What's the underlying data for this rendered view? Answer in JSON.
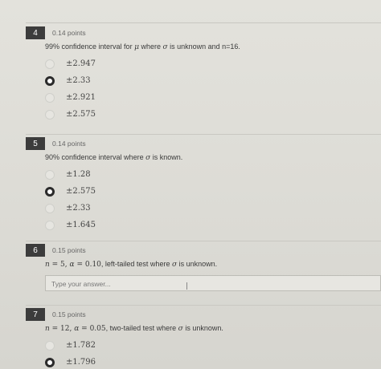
{
  "questions": [
    {
      "number": "4",
      "points": "0.14 points",
      "prompt_text": "99% confidence interval for ",
      "prompt_mu": "μ",
      "prompt_mid": " where ",
      "prompt_sigma": "σ",
      "prompt_end": " is unknown and n=16.",
      "options": [
        "±2.947",
        "±2.33",
        "±2.921",
        "±2.575"
      ],
      "selected_index": 1
    },
    {
      "number": "5",
      "points": "0.14 points",
      "prompt_text": "90% confidence interval where ",
      "prompt_sigma": "σ",
      "prompt_end": " is known.",
      "options": [
        "±1.28",
        "±2.575",
        "±2.33",
        "±1.645"
      ],
      "selected_index": 1
    },
    {
      "number": "6",
      "points": "0.15 points",
      "prompt_n": "n",
      "prompt_eq1": " = 5, ",
      "prompt_alpha": "α",
      "prompt_eq2": " = 0.10",
      "prompt_rest": ", left-tailed test where ",
      "prompt_sigma": "σ",
      "prompt_end": " is unknown.",
      "answer_placeholder": "Type your answer..."
    },
    {
      "number": "7",
      "points": "0.15 points",
      "prompt_n": "n",
      "prompt_eq1": " = 12, ",
      "prompt_alpha": "α",
      "prompt_eq2": " = 0.05",
      "prompt_rest": ", two-tailed test where ",
      "prompt_sigma": "σ",
      "prompt_end": " is unknown.",
      "options": [
        "±1.782",
        "±1.796"
      ],
      "selected_index": 1
    }
  ]
}
